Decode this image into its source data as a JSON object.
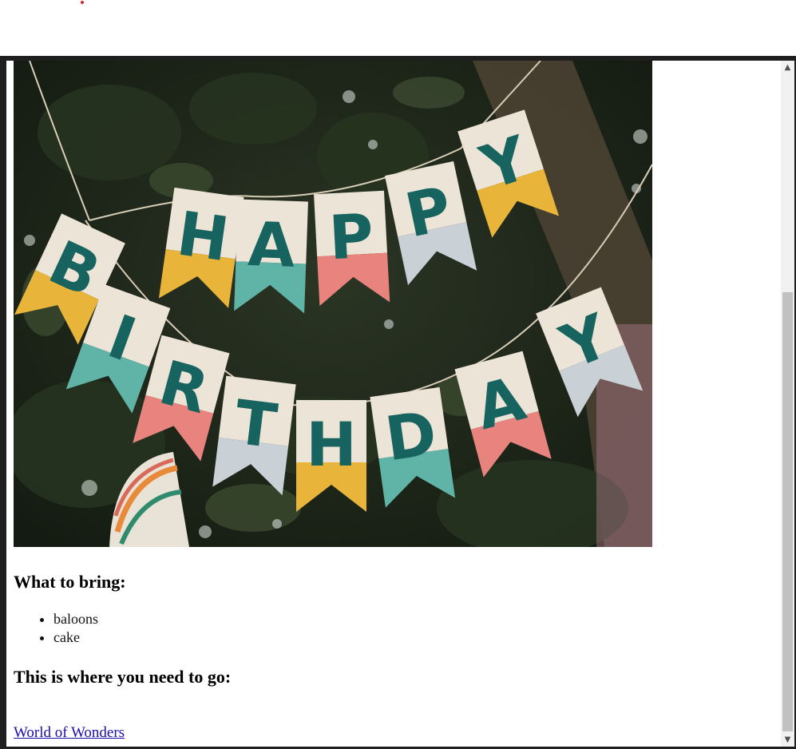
{
  "page": {
    "banner_letters": [
      "H",
      "A",
      "P",
      "P",
      "Y",
      "B",
      "I",
      "R",
      "T",
      "H",
      "D",
      "A",
      "Y"
    ],
    "bring_heading": "What to bring:",
    "bring_items": [
      "baloons",
      "cake"
    ],
    "go_heading": "This is where you need to go:",
    "location_link": "World of Wonders"
  },
  "scrollbar": {
    "up_icon": "▲",
    "down_icon": "▼"
  },
  "colors": {
    "link": "#1a0dab",
    "flag_yellow": "#e9b43a",
    "flag_teal": "#5fb3a7",
    "flag_pink": "#e8837d",
    "flag_grey": "#c9d0d6",
    "letter_teal": "#17635f"
  }
}
